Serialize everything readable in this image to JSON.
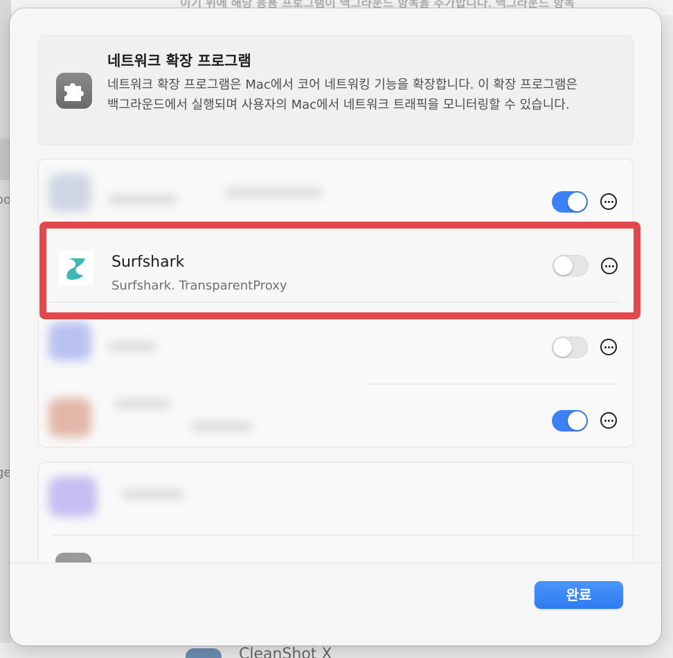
{
  "background": {
    "top_text": "이기 위에 해당 응용 프로그램이 백그라운드 항목을 추가합니다. 백그라운드 항목",
    "left_fragments": [
      "oo",
      "ge"
    ],
    "bottom_app_name": "CleanShot X"
  },
  "info_card": {
    "icon": "puzzle-piece-icon",
    "title": "네트워크 확장 프로그램",
    "description": "네트워크 확장 프로그램은 Mac에서 코어 네트워킹 기능을 확장합니다. 이 확장 프로그램은 백그라운드에서 실행되며 사용자의 Mac에서 네트워크 트래픽을 모니터링할 수 있습니다."
  },
  "extensions": [
    {
      "name": "",
      "identifier": "",
      "enabled": true,
      "blurred": true
    },
    {
      "name": "Surfshark",
      "identifier": "Surfshark. TransparentProxy",
      "enabled": false,
      "blurred": false,
      "icon": "surfshark-logo-icon",
      "accent": "#40b7b5"
    },
    {
      "name": "",
      "identifier": "",
      "enabled": false,
      "blurred": true
    },
    {
      "name": "",
      "identifier": "",
      "enabled": true,
      "blurred": true
    }
  ],
  "footer": {
    "done_label": "완료"
  },
  "colors": {
    "toggle_on": "#3c82f6",
    "highlight": "#e2484b",
    "done_button": "#3a86f7"
  }
}
